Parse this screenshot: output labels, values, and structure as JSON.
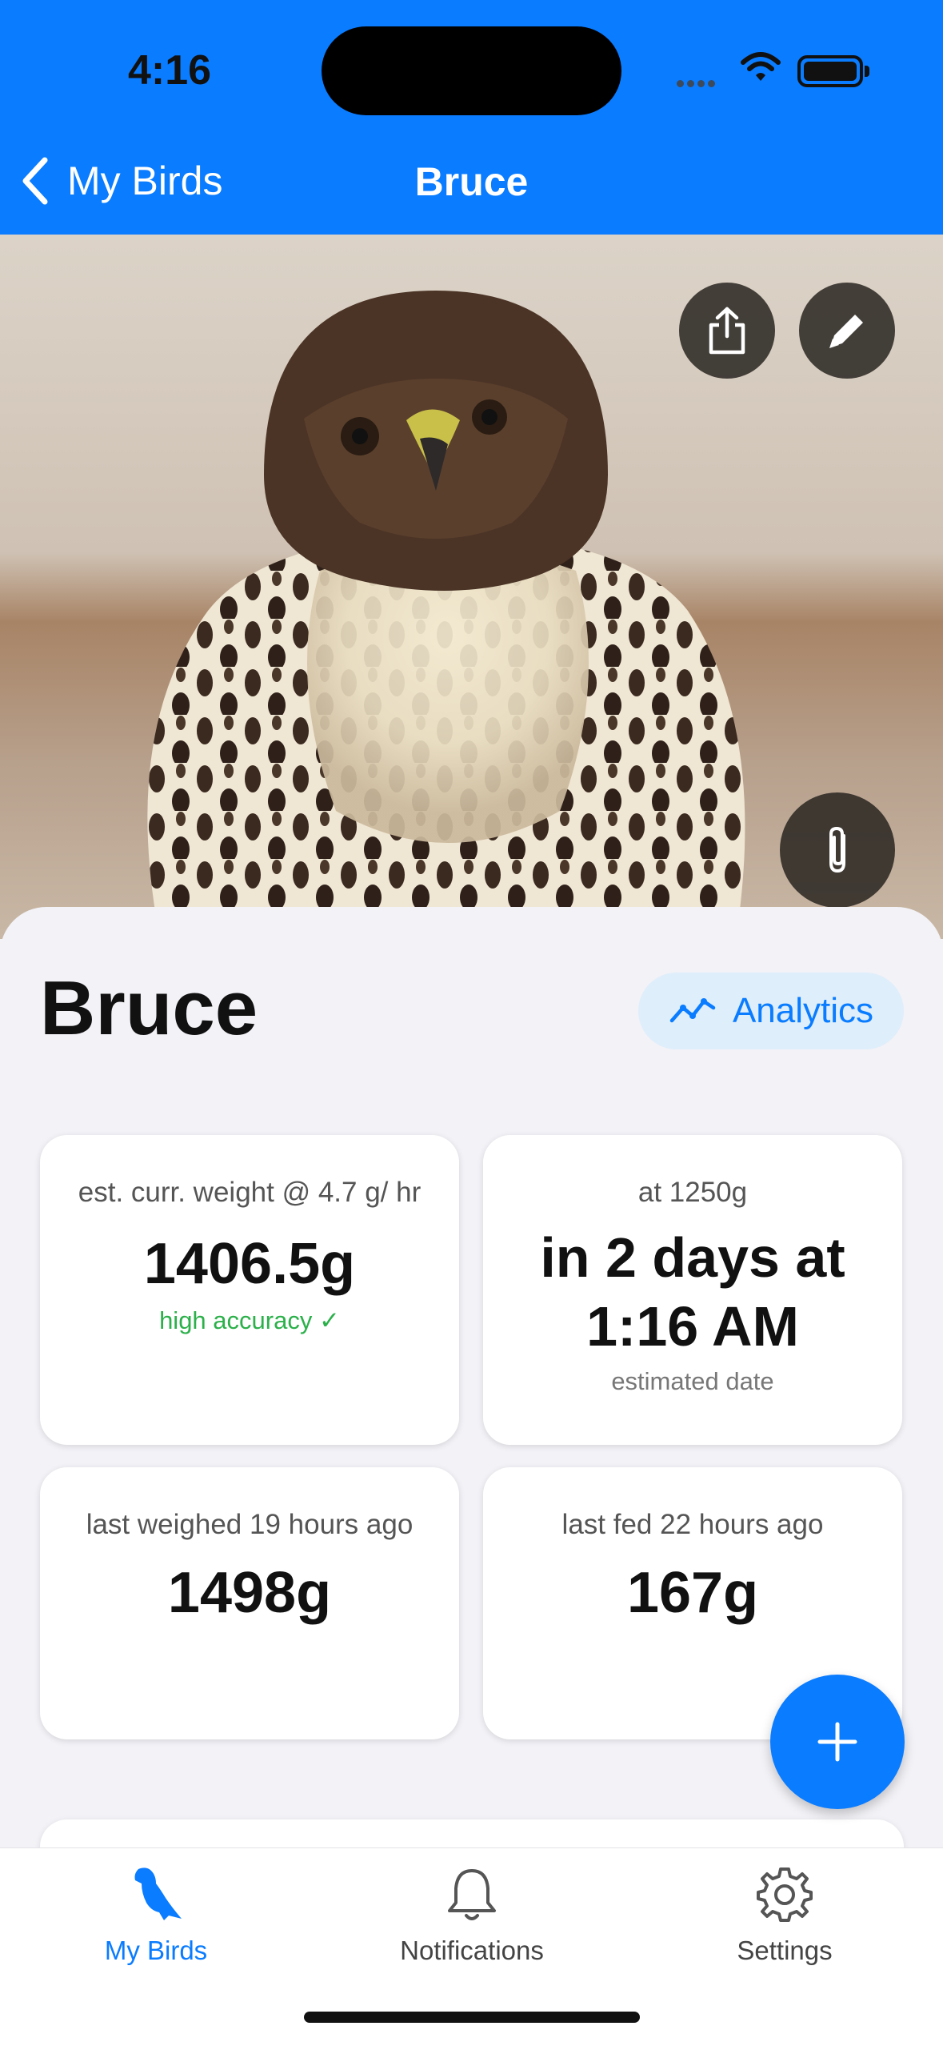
{
  "status_bar": {
    "time": "4:16"
  },
  "nav": {
    "back_label": "My Birds",
    "title": "Bruce"
  },
  "photo": {
    "alt": "Photo of Bruce"
  },
  "bird": {
    "name": "Bruce",
    "analytics_label": "Analytics"
  },
  "cards": {
    "est_weight": {
      "caption": "est. curr. weight @ 4.7 g/ hr",
      "value": "1406.5g",
      "note": "high accuracy ✓"
    },
    "target": {
      "caption": "at 1250g",
      "value_line1": "in 2 days at",
      "value_line2": "1:16 AM",
      "note": "estimated date"
    },
    "last_weighed": {
      "caption": "last weighed 19 hours ago",
      "value": "1498g"
    },
    "last_fed": {
      "caption": "last fed 22 hours ago",
      "value": "167g"
    }
  },
  "tabs": [
    {
      "label": "My Birds",
      "icon": "falcon-icon",
      "active": true
    },
    {
      "label": "Notifications",
      "icon": "bell-icon",
      "active": false
    },
    {
      "label": "Settings",
      "icon": "gear-icon",
      "active": false
    }
  ],
  "colors": {
    "accent": "#0a7cff",
    "success": "#2bb04a",
    "background": "#f2f2f7"
  }
}
